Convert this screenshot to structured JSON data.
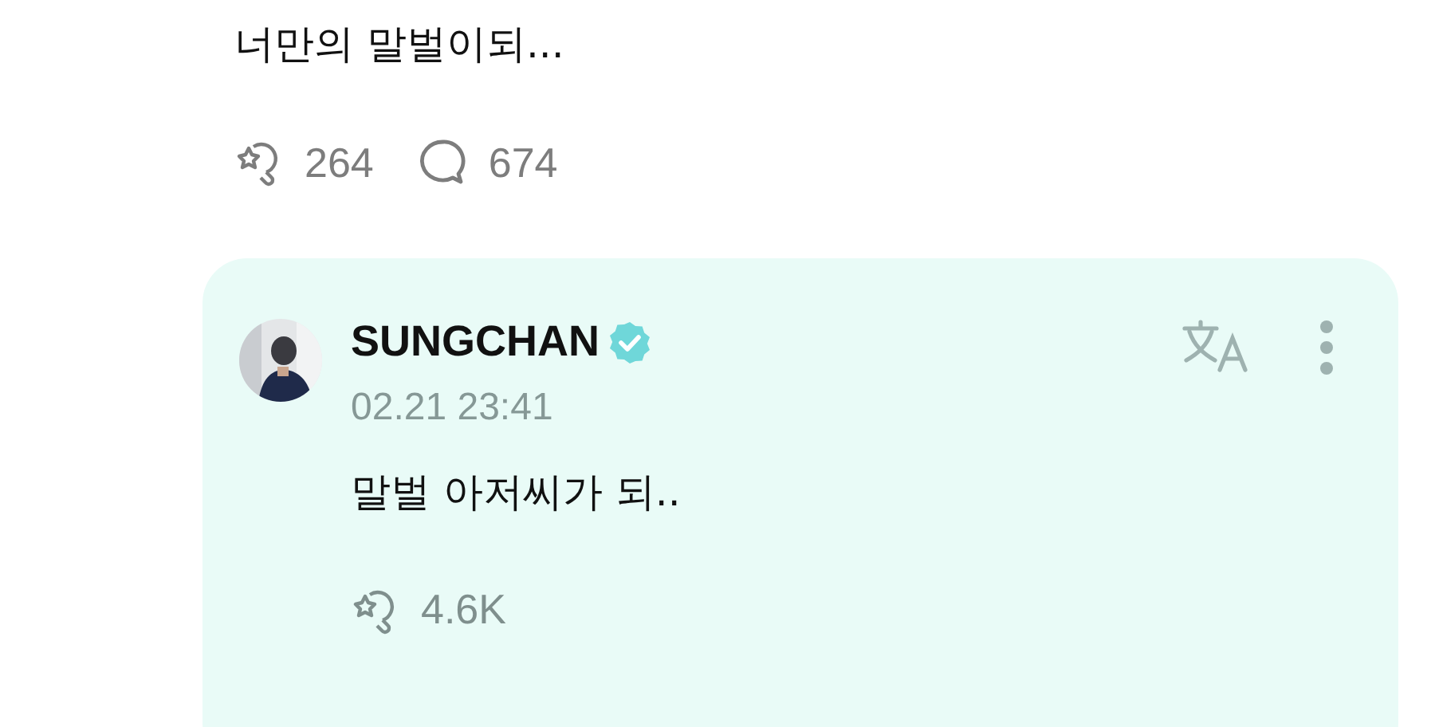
{
  "post": {
    "text": "너만의 말벌이되...",
    "stats": [
      {
        "kind": "reaction",
        "count": "264"
      },
      {
        "kind": "comment",
        "count": "674"
      }
    ]
  },
  "reply": {
    "author": "SUNGCHAN",
    "verified": true,
    "time": "02.21 23:41",
    "text": "말벌 아저씨가 되..",
    "stats": [
      {
        "kind": "reaction",
        "count": "4.6K"
      }
    ]
  }
}
